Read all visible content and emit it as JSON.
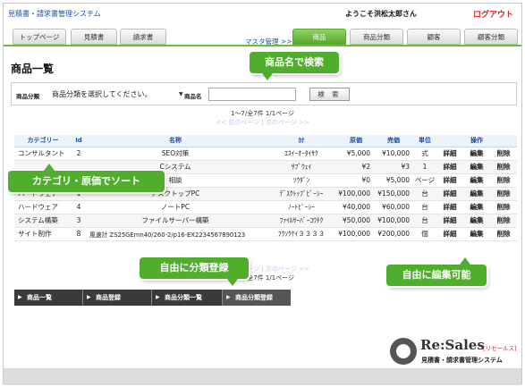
{
  "app": {
    "title": "見積書・請求書管理システム",
    "welcome": "ようこそ洪松太郎さん",
    "logout": "ログアウト"
  },
  "nav": {
    "left_tabs": [
      "トップページ",
      "見積書",
      "請求書"
    ],
    "master_label": "マスタ管理 >>",
    "master_tabs": [
      "商品",
      "商品分類",
      "顧客",
      "顧客分類"
    ],
    "active_tab": "商品"
  },
  "page": {
    "title": "商品一覧"
  },
  "search": {
    "category_label": "商品分類",
    "category_value": "商品分類を選択してください。",
    "name_label": "商品名",
    "name_value": "",
    "button": "検 索"
  },
  "pager": {
    "summary": "1～7/全7件 1/1ページ",
    "links": "<< 前のページ | 次のページ >>"
  },
  "table": {
    "headers": [
      "カテゴリー",
      "Id",
      "名称",
      "ｶﾅ",
      "原価",
      "売価",
      "単位",
      "操作"
    ],
    "rows": [
      {
        "category": "コンサルタント",
        "id": "2",
        "name": "SEO対策",
        "kana": "ｴｽｲｰｵｰﾀｲｻｸ",
        "cost": "¥5,000",
        "price": "¥10,000",
        "unit": "式"
      },
      {
        "category": "",
        "id": "",
        "name": "Cシステム",
        "kana": "ｻﾌﾞｳｪｲ",
        "cost": "¥2",
        "price": "¥3",
        "unit": "1"
      },
      {
        "category": "",
        "id": "",
        "name": "相談",
        "kana": "ｿｳﾀﾞﾝ",
        "cost": "¥0",
        "price": "¥5,000",
        "unit": "ページ"
      },
      {
        "category": "ハードウェア",
        "id": "1",
        "name": "デスクトップPC",
        "kana": "ﾃﾞｽｸﾄｯﾌﾟﾋﾟｰｼｰ",
        "cost": "¥100,000",
        "price": "¥150,000",
        "unit": "台"
      },
      {
        "category": "ハードウェア",
        "id": "4",
        "name": "ノートPC",
        "kana": "ﾉｰﾄﾋﾟｰｼｰ",
        "cost": "¥40,000",
        "price": "¥60,000",
        "unit": "台"
      },
      {
        "category": "システム構築",
        "id": "3",
        "name": "ファイルサーバー構築",
        "kana": "ﾌｧｲﾙｻｰﾊﾞｰｺｳﾁｸ",
        "cost": "¥50,000",
        "price": "¥100,000",
        "unit": "台"
      },
      {
        "category": "サイト制作",
        "id": "8",
        "name": "風速計 ZS25GEmn40/260-2/p16-EX2234567890123",
        "kana": "ﾌｳｿｸｹｲ３３３３",
        "cost": "¥100,000",
        "price": "¥200,000",
        "unit": "個"
      }
    ],
    "actions": [
      "詳細",
      "編集",
      "削除"
    ]
  },
  "bottom_tabs": [
    "商品一覧",
    "商品登録",
    "商品分類一覧",
    "商品分類登録"
  ],
  "callouts": {
    "search": "商品名で検索",
    "sort": "カテゴリ・原価でソート",
    "register": "自由に分類登録",
    "edit": "自由に編集可能"
  },
  "brand": {
    "name": "Re:Sales",
    "sub": "[リセールス]",
    "tagline": "見積書・請求書管理システム"
  },
  "colors": {
    "accent_green": "#4fae2c",
    "link_blue": "#1a4fa0",
    "logout_red": "#e02020"
  },
  "icons": [
    "dropdown-arrow-icon",
    "resales-logo-icon",
    "triangle-right-icon"
  ]
}
